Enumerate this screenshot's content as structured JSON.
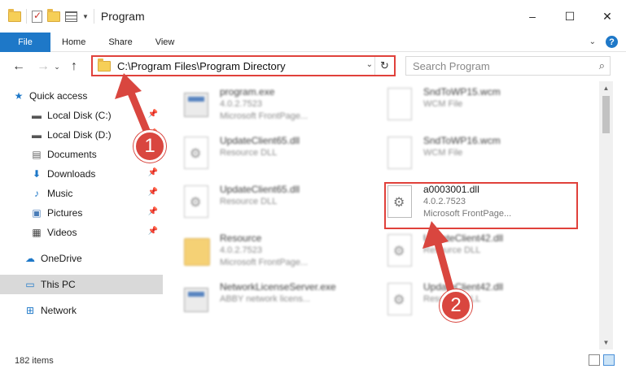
{
  "window": {
    "title": "Program",
    "controls": {
      "minimize": "–",
      "maximize": "☐",
      "close": "✕"
    }
  },
  "ribbon": {
    "tabs": [
      "File",
      "Home",
      "Share",
      "View"
    ],
    "help": "?"
  },
  "address": {
    "path": "C:\\Program Files\\Program Directory",
    "search_placeholder": "Search Program"
  },
  "sidebar": {
    "items": [
      {
        "label": "Quick access",
        "icon": "star-icon",
        "pinned": false
      },
      {
        "label": "Local Disk (C:)",
        "icon": "drive-icon",
        "pinned": true
      },
      {
        "label": "Local Disk (D:)",
        "icon": "drive-icon",
        "pinned": true
      },
      {
        "label": "Documents",
        "icon": "documents-icon",
        "pinned": true
      },
      {
        "label": "Downloads",
        "icon": "download-icon",
        "pinned": true
      },
      {
        "label": "Music",
        "icon": "music-icon",
        "pinned": true
      },
      {
        "label": "Pictures",
        "icon": "pictures-icon",
        "pinned": true
      },
      {
        "label": "Videos",
        "icon": "videos-icon",
        "pinned": true
      },
      {
        "label": "OneDrive",
        "icon": "cloud-icon",
        "pinned": false
      },
      {
        "label": "This PC",
        "icon": "computer-icon",
        "pinned": false
      },
      {
        "label": "Network",
        "icon": "network-icon",
        "pinned": false
      }
    ]
  },
  "files": [
    {
      "name": "program.exe",
      "line2": "4.0.2.7523",
      "line3": "Microsoft FrontPage...",
      "kind": "exe"
    },
    {
      "name": "SndToWP15.wcm",
      "line2": "WCM File",
      "line3": "",
      "kind": "doc"
    },
    {
      "name": "UpdateClient65.dll",
      "line2": "Resource DLL",
      "line3": "",
      "kind": "dll"
    },
    {
      "name": "SndToWP16.wcm",
      "line2": "WCM File",
      "line3": "",
      "kind": "doc"
    },
    {
      "name": "UpdateClient65.dll",
      "line2": "Resource DLL",
      "line3": "",
      "kind": "dll"
    },
    {
      "name": "a0003001.dll",
      "line2": "4.0.2.7523",
      "line3": "Microsoft FrontPage...",
      "kind": "dll"
    },
    {
      "name": "Resource",
      "line2": "4.0.2.7523",
      "line3": "Microsoft FrontPage...",
      "kind": "folder"
    },
    {
      "name": "UpdateClient42.dll",
      "line2": "Resource DLL",
      "line3": "",
      "kind": "dll"
    },
    {
      "name": "NetworkLicenseServer.exe",
      "line2": "ABBY network licens...",
      "line3": "",
      "kind": "exe"
    },
    {
      "name": "UpdateClient42.dll",
      "line2": "Resource DLL",
      "line3": "",
      "kind": "dll"
    }
  ],
  "status": {
    "item_count": "182 items"
  },
  "callouts": {
    "step1": "1",
    "step2": "2"
  },
  "colors": {
    "accent": "#1e78c8",
    "highlight": "#e0413b",
    "badge": "#d9463f"
  }
}
